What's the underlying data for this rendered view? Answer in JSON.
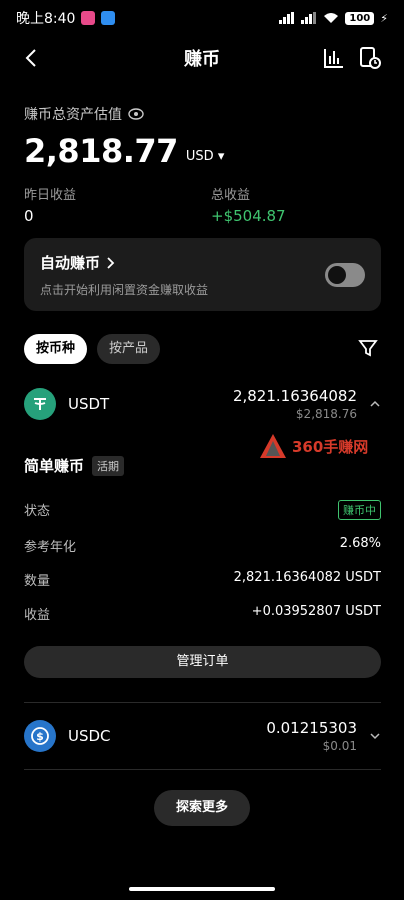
{
  "status": {
    "time": "晚上8:40",
    "battery": "100"
  },
  "header": {
    "title": "赚币"
  },
  "assets": {
    "label": "赚币总资产估值",
    "value": "2,818.77",
    "currency": "USD"
  },
  "stats": {
    "yesterday_label": "昨日收益",
    "yesterday_value": "0",
    "total_label": "总收益",
    "total_value": "+$504.87"
  },
  "auto_earn": {
    "title": "自动赚币",
    "subtitle": "点击开始利用闲置资金赚取收益"
  },
  "tabs": [
    {
      "label": "按币种"
    },
    {
      "label": "按产品"
    }
  ],
  "coins": [
    {
      "name": "USDT",
      "amount": "2,821.16364082",
      "usd": "$2,818.76",
      "color": "#26a17b"
    },
    {
      "name": "USDC",
      "amount": "0.01215303",
      "usd": "$0.01",
      "color": "#2775ca"
    }
  ],
  "detail": {
    "title": "简单赚币",
    "tag": "活期",
    "rows": [
      {
        "k": "状态",
        "v": "赚币中"
      },
      {
        "k": "参考年化",
        "v": "2.68%"
      },
      {
        "k": "数量",
        "v": "2,821.16364082 USDT"
      },
      {
        "k": "收益",
        "v": "+0.03952807 USDT"
      }
    ],
    "manage": "管理订单"
  },
  "explore": "探索更多",
  "watermark": "360手赚网"
}
